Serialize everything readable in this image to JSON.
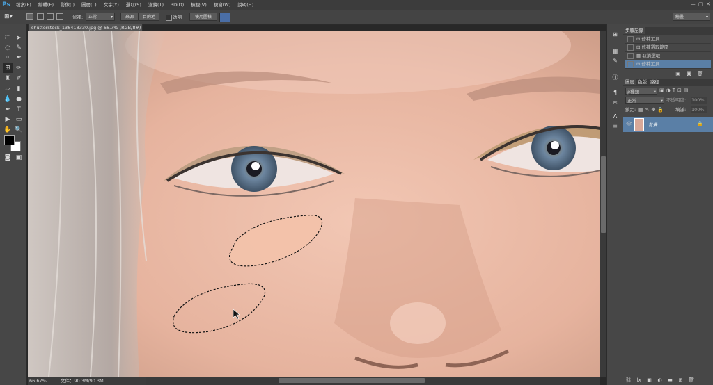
{
  "app": {
    "logo": "Ps"
  },
  "menu": [
    "檔案(F)",
    "編輯(E)",
    "影像(I)",
    "圖層(L)",
    "文字(Y)",
    "選取(S)",
    "濾鏡(T)",
    "3D(D)",
    "檢視(V)",
    "視窗(W)",
    "說明(H)"
  ],
  "options": {
    "patch_label": "修補:",
    "patch_mode": "正常",
    "source": "來源",
    "destination": "目的地",
    "transparent": "透明",
    "use_pattern": "使用圖樣",
    "workspace": "繪畫"
  },
  "document": {
    "tab_title": "shutterstock_136418330.jpg @ 66.7% (RGB/8#) *",
    "close": "×",
    "zoom": "66.67%",
    "file_info": "文件：90.3M/90.3M"
  },
  "history": {
    "tab_label": "步驟記錄",
    "items": [
      "修補工具",
      "修補選取範圍",
      "取消選取",
      "修補工具"
    ]
  },
  "layers": {
    "tabs": [
      "圖層",
      "色版",
      "路徑"
    ],
    "kind_filter": "ρ種類",
    "blend_mode": "正常",
    "opacity_label": "不透明度:",
    "opacity_value": "100%",
    "lock_label": "鎖定:",
    "fill_label": "填滿:",
    "fill_value": "100%",
    "layer_name": "背景"
  },
  "colors": {
    "accent": "#5a7fa6",
    "ui_dark": "#282828",
    "panel": "#474747"
  }
}
